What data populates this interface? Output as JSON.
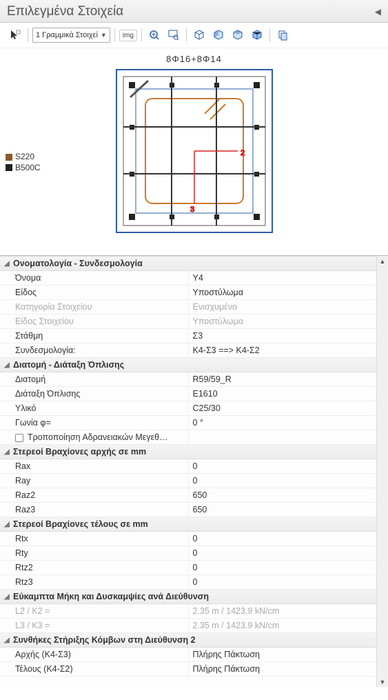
{
  "panel": {
    "title": "Επιλεγμένα Στοιχεία"
  },
  "toolbar": {
    "dropdown_label": "1 Γραμμικά Στοιχεί",
    "img_label": "img"
  },
  "preview": {
    "title": "8Φ16+8Φ14",
    "legend1": "S220",
    "legend2": "B500C"
  },
  "groups": [
    {
      "title": "Ονοματολογία - Συνδεσμολογία",
      "rows": [
        {
          "k": "Όνομα",
          "v": "Υ4"
        },
        {
          "k": "Είδος",
          "v": "Υποστύλωμα"
        },
        {
          "k": "Κατηγορία Στοιχείου",
          "v": "Ενισχυμένο",
          "disabled": true
        },
        {
          "k": "Είδος Στοιχείου",
          "v": "Υποστύλωμα",
          "disabled": true
        },
        {
          "k": "Στάθμη",
          "v": "Σ3"
        },
        {
          "k": "Συνδεσμολογία:",
          "v": "K4-Σ3 ==> K4-Σ2"
        }
      ]
    },
    {
      "title": "Διατομή - Διάταξη Όπλισης",
      "rows": [
        {
          "k": "Διατομή",
          "v": "R59/59_R"
        },
        {
          "k": "Διάταξη Όπλισης",
          "v": "E1610"
        },
        {
          "k": "Υλικό",
          "v": "C25/30"
        },
        {
          "k": "Γωνία φ=",
          "v": "0 °"
        },
        {
          "k": "Τροποποίηση Αδρανειακών Μεγεθ…",
          "v": "",
          "checkbox": true
        }
      ]
    },
    {
      "title": "Στερεοί Βραχίονες αρχής σε mm",
      "rows": [
        {
          "k": "Rax",
          "v": "0"
        },
        {
          "k": "Ray",
          "v": "0"
        },
        {
          "k": "Raz2",
          "v": "650"
        },
        {
          "k": "Raz3",
          "v": "650"
        }
      ]
    },
    {
      "title": "Στερεοί Βραχίονες τέλους σε mm",
      "rows": [
        {
          "k": "Rtx",
          "v": "0"
        },
        {
          "k": "Rty",
          "v": "0"
        },
        {
          "k": "Rtz2",
          "v": "0"
        },
        {
          "k": "Rtz3",
          "v": "0"
        }
      ]
    },
    {
      "title": "Εύκαμπτα Μήκη και Δυσκαμψίες ανά Διεύθυνση",
      "rows": [
        {
          "k": "L2 / K2 =",
          "v": "2.35 m / 1423.9 kN/cm",
          "disabled": true
        },
        {
          "k": "L3 / K3 =",
          "v": "2.35 m / 1423.9 kN/cm",
          "disabled": true
        }
      ]
    },
    {
      "title": "Συνθήκες Στήριξης Κόμβων στη Διεύθυνση 2",
      "rows": [
        {
          "k": "Αρχής (K4-Σ3)",
          "v": "Πλήρης Πάκτωση"
        },
        {
          "k": "Τέλους (K4-Σ2)",
          "v": "Πλήρης Πάκτωση"
        }
      ]
    }
  ]
}
